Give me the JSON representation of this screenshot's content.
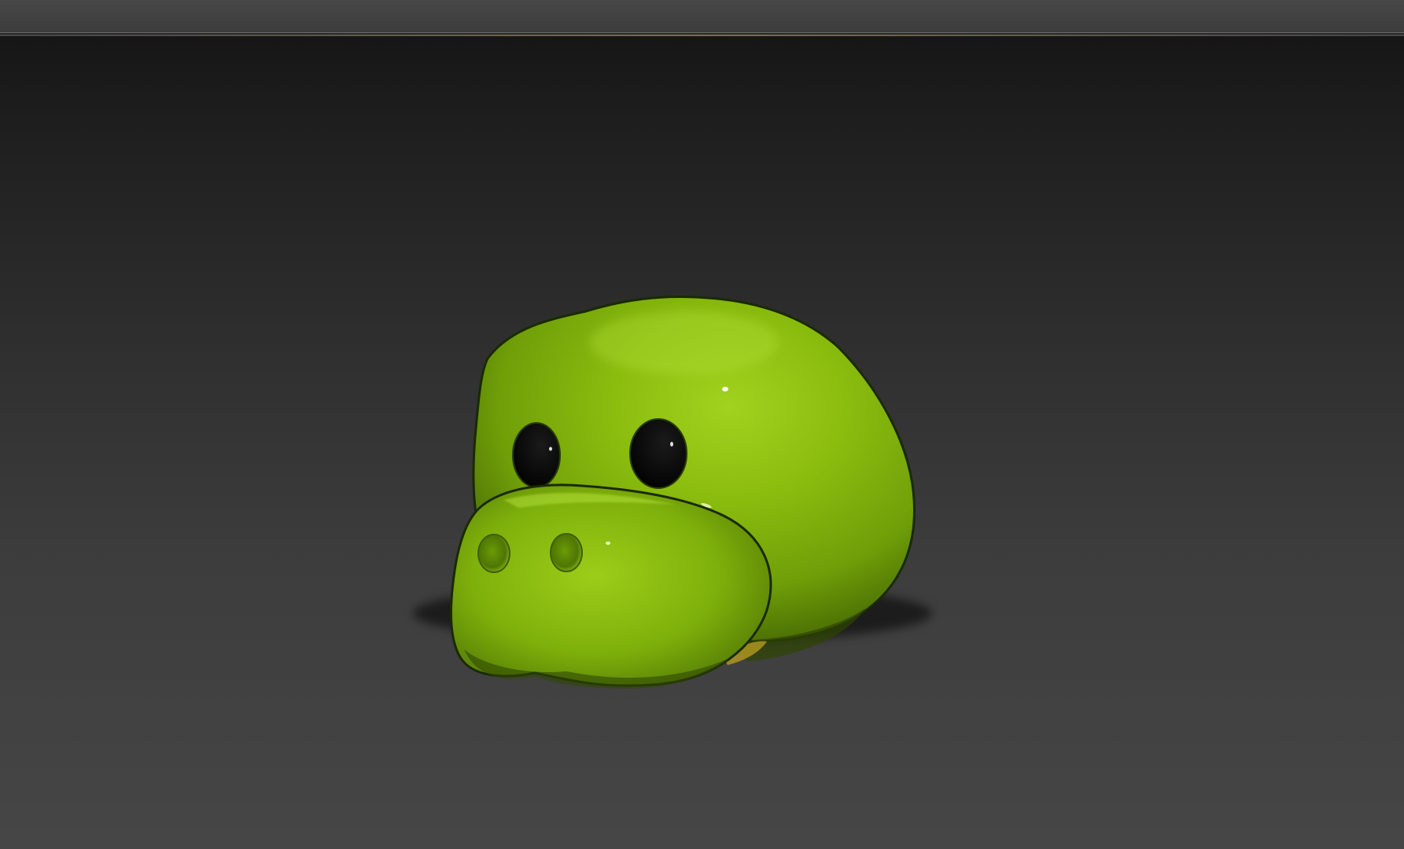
{
  "viewport": {
    "shading": "smooth-highlights"
  },
  "model": {
    "object": "cartoon-creature-head",
    "body_color": "#7aac0a",
    "body_highlight_color": "#a6d62a",
    "body_shadow_color": "#3e5c05",
    "eye_color": "#050505",
    "background_top": "#161616",
    "background_bottom": "#464646"
  }
}
